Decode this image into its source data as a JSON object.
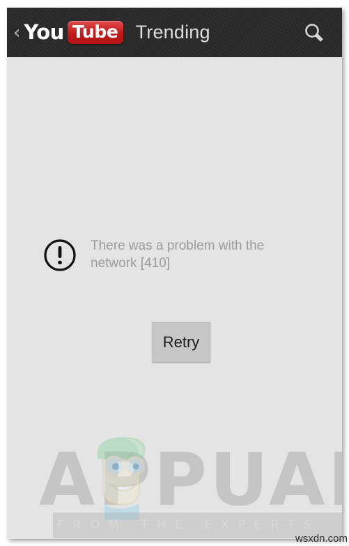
{
  "app": {
    "name": "YouTube",
    "logo_you": "You",
    "logo_tube": "Tube",
    "back_icon": "back-chevron-icon",
    "title": "Trending",
    "search_icon": "search-icon",
    "header_bg": "#2b2b2b",
    "brand_red": "#c21b1b"
  },
  "content": {
    "error_icon": "exclamation-circle-icon",
    "error_message": "There was a problem with the network [410]",
    "retry_label": "Retry",
    "background": "#e4e4e4",
    "error_text_color": "#9c9c9c"
  },
  "watermark": {
    "brand": "APPUALS",
    "tagline": "FROM THE EXPERTS",
    "mascot": "appuals-mascot-icon",
    "credit": "wsxdn.com"
  }
}
